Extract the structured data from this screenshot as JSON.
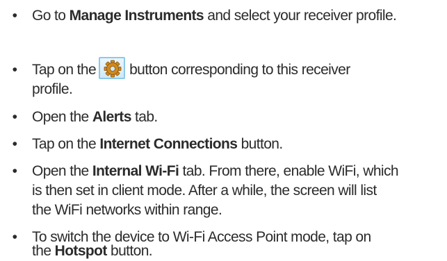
{
  "bullet_char": "•",
  "steps": [
    {
      "pre": "Go to ",
      "bold": "Manage Instruments",
      "post": " and select your receiver profile."
    },
    {
      "pre": "Tap on the",
      "icon": "gear-icon",
      "post_line1": "button corresponding to this receiver",
      "post_line2": "profile."
    },
    {
      "pre": "Open the ",
      "bold": "Alerts",
      "post": " tab."
    },
    {
      "pre": "Tap on the ",
      "bold": "Internet Connections",
      "post": " button."
    },
    {
      "pre": "Open the ",
      "bold": "Internal Wi-Fi",
      "post_line1": " tab. From there, enable WiFi, which",
      "post_line2": "is then set in client mode. After a while, the screen will list",
      "post_line3": "the WiFi networks within range."
    },
    {
      "line1": "To switch the device to Wi-Fi Access Point mode, tap on",
      "pre2": "the ",
      "bold": "Hotspot",
      "post": " button."
    }
  ],
  "colors": {
    "text": "#2b2b2b",
    "icon_gear": "#d08a1a",
    "icon_border": "#8fc8e8"
  }
}
